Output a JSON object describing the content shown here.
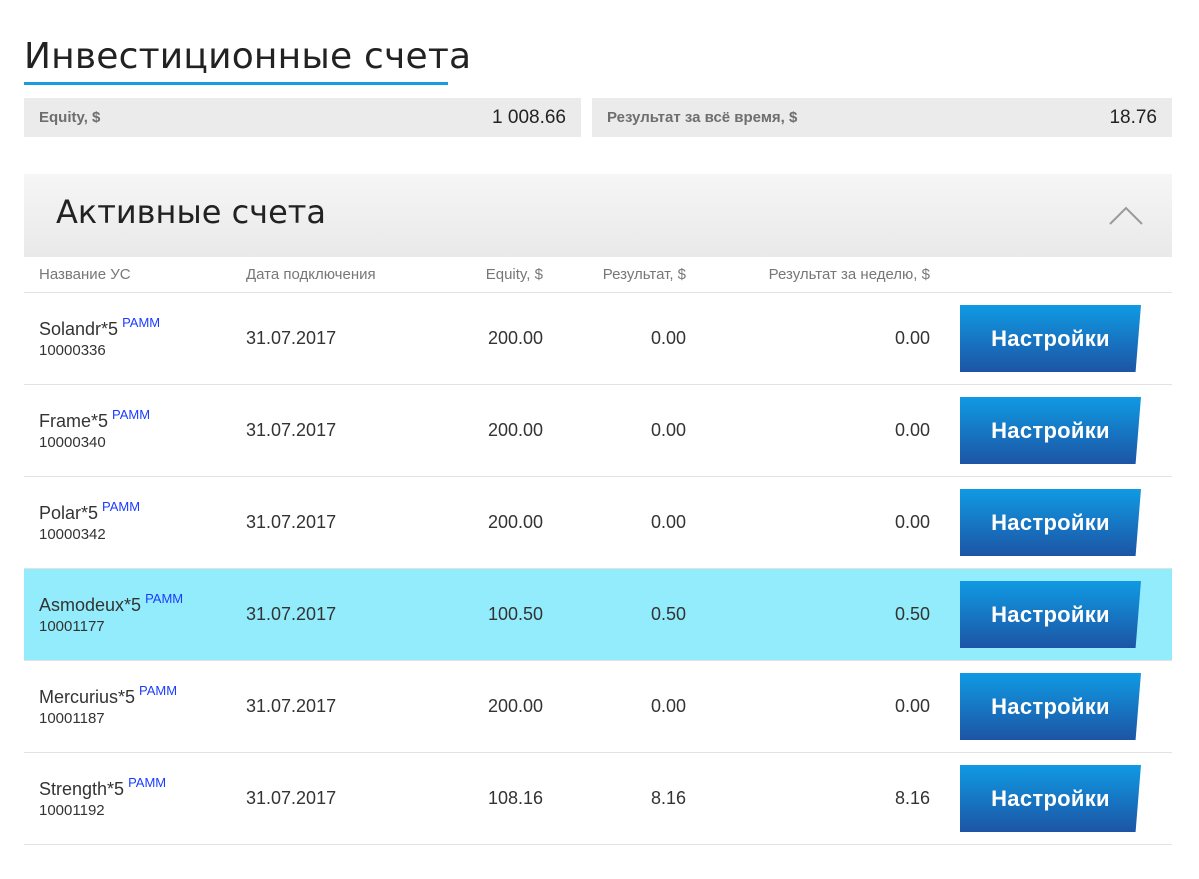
{
  "page": {
    "title": "Инвестиционные счета"
  },
  "summary": {
    "equity_label": "Equity, $",
    "equity_value": "1 008.66",
    "result_label": "Результат за всё время, $",
    "result_value": "18.76"
  },
  "panel": {
    "title": "Активные счета",
    "collapse_icon": "chevron-up-icon"
  },
  "table": {
    "headers": {
      "name": "Название УС",
      "date": "Дата подключения",
      "equity": "Equity, $",
      "result": "Результат, $",
      "week_result": "Результат за неделю, $"
    },
    "rows": [
      {
        "name": "Solandr*5",
        "type": "PAMM",
        "number": "10000336",
        "date": "31.07.2017",
        "equity": "200.00",
        "result": "0.00",
        "week_result": "0.00",
        "button": "Настройки"
      },
      {
        "name": "Frame*5",
        "type": "PAMM",
        "number": "10000340",
        "date": "31.07.2017",
        "equity": "200.00",
        "result": "0.00",
        "week_result": "0.00",
        "button": "Настройки"
      },
      {
        "name": "Polar*5",
        "type": "PAMM",
        "number": "10000342",
        "date": "31.07.2017",
        "equity": "200.00",
        "result": "0.00",
        "week_result": "0.00",
        "button": "Настройки"
      },
      {
        "name": "Asmodeux*5",
        "type": "PAMM",
        "number": "10001177",
        "date": "31.07.2017",
        "equity": "100.50",
        "result": "0.50",
        "week_result": "0.50",
        "button": "Настройки"
      },
      {
        "name": "Mercurius*5",
        "type": "PAMM",
        "number": "10001187",
        "date": "31.07.2017",
        "equity": "200.00",
        "result": "0.00",
        "week_result": "0.00",
        "button": "Настройки"
      },
      {
        "name": "Strength*5",
        "type": "PAMM",
        "number": "10001192",
        "date": "31.07.2017",
        "equity": "108.16",
        "result": "8.16",
        "week_result": "8.16",
        "button": "Настройки"
      }
    ]
  },
  "colors": {
    "accent": "#1a9ce0",
    "highlight_row": "#93ecfc",
    "button_top": "#109ae3",
    "button_bottom": "#1c55a5",
    "pamm_link": "#1a3cff"
  }
}
